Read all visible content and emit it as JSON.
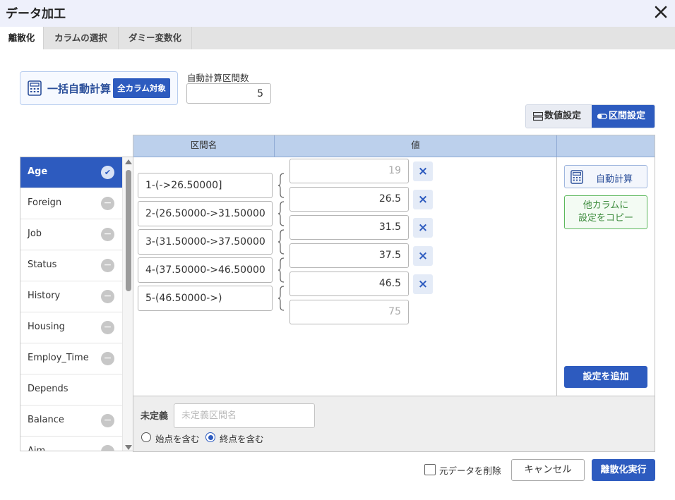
{
  "window": {
    "title": "データ加工"
  },
  "tabs": [
    {
      "label": "離散化",
      "active": true
    },
    {
      "label": "カラムの選択",
      "active": false
    },
    {
      "label": "ダミー変数化",
      "active": false
    }
  ],
  "bulk_calc": {
    "label": "一括自動計算",
    "all_columns_button": "全カラム対象"
  },
  "intervals": {
    "label": "自動計算区間数",
    "value": "5"
  },
  "mode_toggle": {
    "numeric_label": "数値設定",
    "interval_label": "区間設定",
    "active": "interval"
  },
  "columns": [
    {
      "name": "Age",
      "status": "checked",
      "selected": true
    },
    {
      "name": "Foreign",
      "status": "minus"
    },
    {
      "name": "Job",
      "status": "minus"
    },
    {
      "name": "Status",
      "status": "minus"
    },
    {
      "name": "History",
      "status": "minus"
    },
    {
      "name": "Housing",
      "status": "minus"
    },
    {
      "name": "Employ_Time",
      "status": "minus"
    },
    {
      "name": "Depends",
      "status": "none"
    },
    {
      "name": "Balance",
      "status": "minus"
    },
    {
      "name": "Aim",
      "status": "minus"
    }
  ],
  "grid": {
    "header_name": "区間名",
    "header_value": "値",
    "bins": [
      {
        "name": "1-(->26.50000]"
      },
      {
        "name": "2-(26.50000->31.50000"
      },
      {
        "name": "3-(31.50000->37.50000"
      },
      {
        "name": "4-(37.50000->46.50000"
      },
      {
        "name": "5-(46.50000->)"
      }
    ],
    "boundaries": [
      {
        "value": "19",
        "muted": true,
        "deletable": true
      },
      {
        "value": "26.5",
        "muted": false,
        "deletable": true
      },
      {
        "value": "31.5",
        "muted": false,
        "deletable": true
      },
      {
        "value": "37.5",
        "muted": false,
        "deletable": true
      },
      {
        "value": "46.5",
        "muted": false,
        "deletable": true
      },
      {
        "value": "75",
        "muted": true,
        "deletable": false
      }
    ],
    "delete_symbol": "×"
  },
  "side_actions": {
    "auto_calc": "自動計算",
    "copy_line1": "他カラムに",
    "copy_line2": "設定をコピー",
    "add_setting": "設定を追加"
  },
  "undefined_section": {
    "label": "未定義",
    "placeholder": "未定義区間名",
    "include_start": "始点を含む",
    "include_end": "終点を含む",
    "selected": "end"
  },
  "footer": {
    "delete_original_label": "元データを削除",
    "delete_original_checked": false,
    "cancel_label": "キャンセル",
    "execute_label": "離散化実行"
  },
  "colors": {
    "accent": "#2d5bbf",
    "header": "#bcd0ec",
    "green": "#5cb85c"
  }
}
